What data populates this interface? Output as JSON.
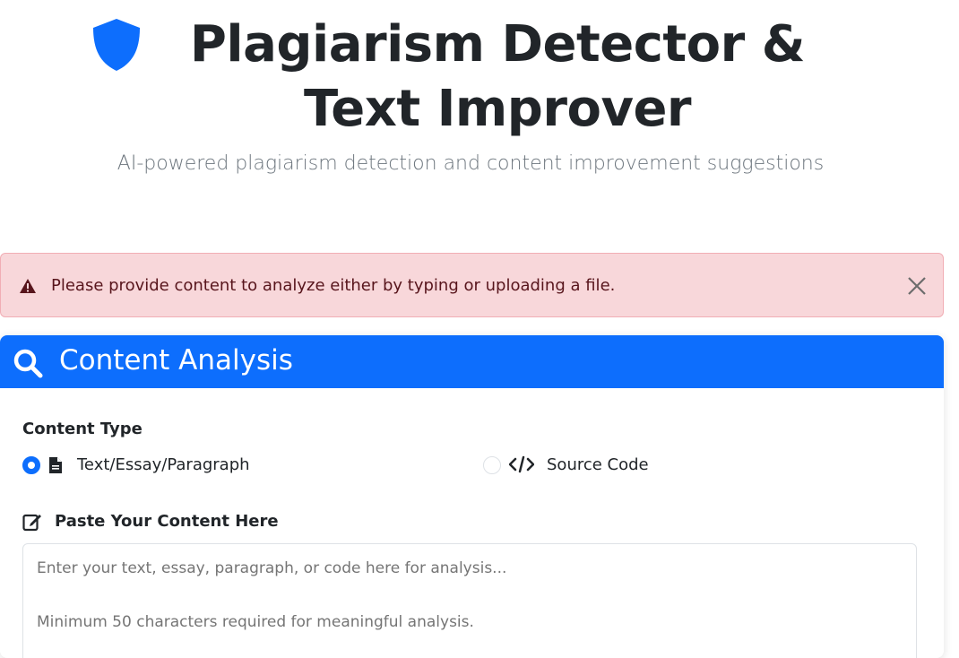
{
  "header": {
    "title": "Plagiarism Detector & Text Improver",
    "subtitle": "AI-powered plagiarism detection and content improvement suggestions",
    "icon": "shield-icon"
  },
  "alert": {
    "message": "Please provide content to analyze either by typing or uploading a file.",
    "icon": "warning-icon",
    "close_icon": "close-icon"
  },
  "card": {
    "title": "Content Analysis",
    "icon": "search-icon",
    "content_type_label": "Content Type",
    "options": [
      {
        "label": "Text/Essay/Paragraph",
        "icon": "file-icon",
        "selected": true
      },
      {
        "label": "Source Code",
        "icon": "code-icon",
        "selected": false
      }
    ],
    "paste_label": "Paste Your Content Here",
    "paste_icon": "edit-icon",
    "textarea_placeholder": "Enter your text, essay, paragraph, or code here for analysis...\n\nMinimum 50 characters required for meaningful analysis."
  },
  "colors": {
    "accent": "#0d6efd",
    "alert_bg": "#f8d7da",
    "alert_text": "#58151c"
  }
}
